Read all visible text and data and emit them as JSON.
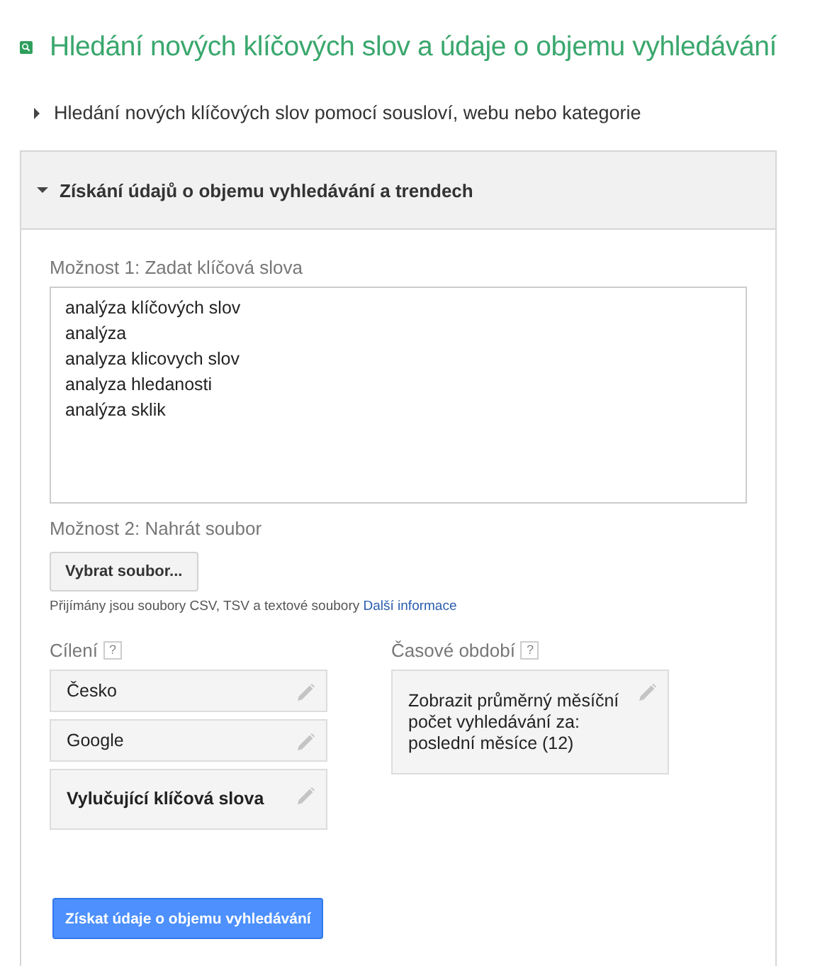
{
  "title": "Hledání nových klíčových slov a údaje o objemu vyhledávání",
  "sections": [
    {
      "label": "Hledání nových klíčových slov pomocí sousloví, webu nebo kategorie",
      "expanded": false
    },
    {
      "label": "Získání údajů o objemu vyhledávání a trendech",
      "expanded": true
    }
  ],
  "option_1": {
    "label": "Možnost 1: Zadat klíčová slova",
    "value": [
      "analýza klíčových slov",
      "analýza",
      "analyza klicovych slov",
      "analyza hledanosti",
      "analýza sklik"
    ]
  },
  "option_2": {
    "label": "Možnost 2: Nahrát soubor",
    "button": "Vybrat soubor...",
    "note": "Přijímány jsou soubory CSV, TSV a textové soubory",
    "link": "Další informace"
  },
  "targeting": {
    "label": "Cílení",
    "help": "?",
    "items": [
      {
        "kind": "value",
        "text": "Česko"
      },
      {
        "kind": "value",
        "text": "Google"
      },
      {
        "kind": "heading",
        "text": "Vylučující klíčová slova"
      }
    ]
  },
  "period": {
    "label": "Časové období",
    "help": "?",
    "text": "Zobrazit průměrný měsíční počet vyhledávání za: poslední měsíce (12)"
  },
  "submit": "Získat údaje o objemu vyhledávání"
}
